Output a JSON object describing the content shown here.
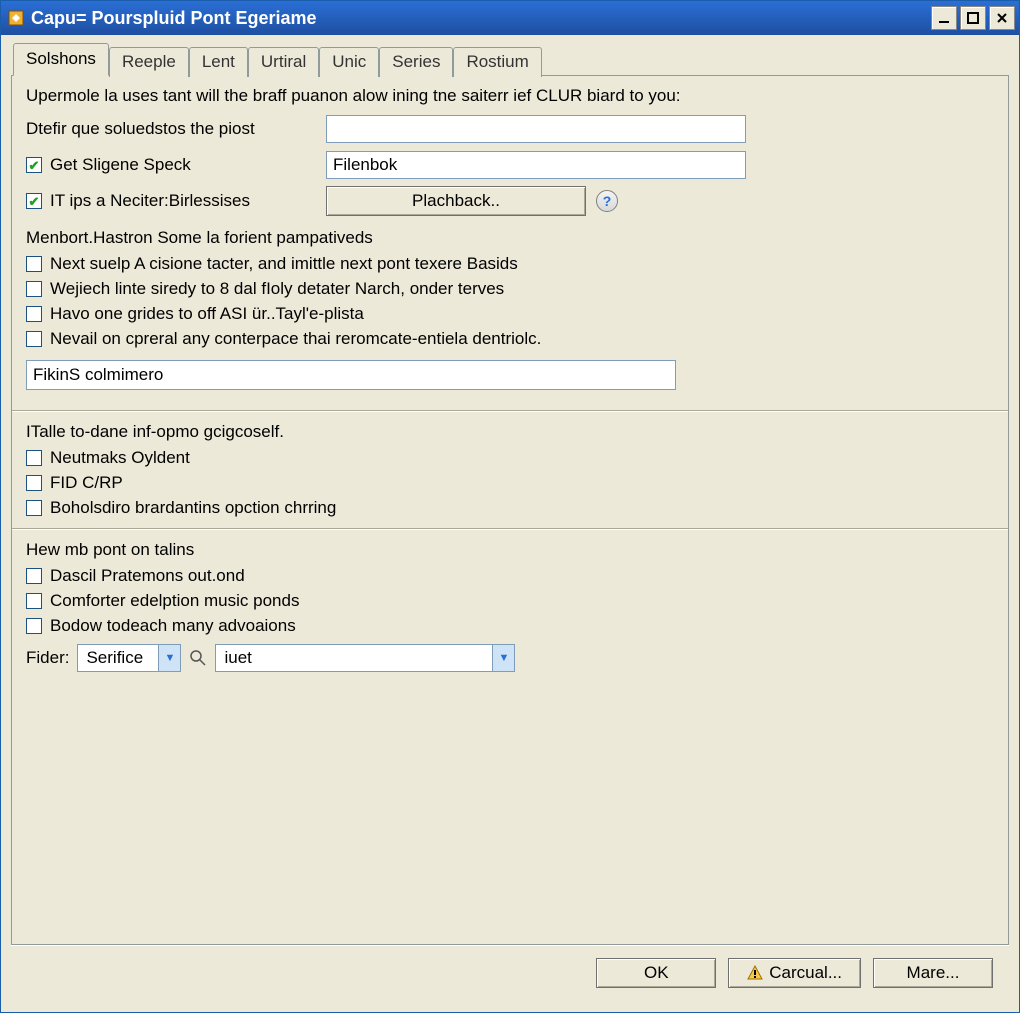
{
  "window": {
    "title": "Capu= Pourspluid Pont Egeriame"
  },
  "tabs": [
    "Solshons",
    "Reeple",
    "Lent",
    "Urtiral",
    "Unic",
    "Series",
    "Rostium"
  ],
  "activeTab": 0,
  "panel": {
    "intro": "Upermole la uses tant will the braff puanon alow ining tne saiterr ief CLUR biard to you:",
    "row1_label": "Dtefir que soluedstos the piost",
    "row1_value": "",
    "chk_sligene": "Get Sligene Speck",
    "row2_value": "Filenbok",
    "chk_itips": "IT ips a Neciter:Birlessises",
    "btn_playback": "Plachback..",
    "section_menbort": "Menbort.Hastron Some la forient pampativeds",
    "chk_next": "Next suelp A cisione tacter, and imittle next pont texere Basids",
    "chk_wej": "Wejiech linte siredy to 8 dal fIoly detater Narch, onder terves",
    "chk_havo": "Havo one grides to off ASI ür..Tayl'e-plista",
    "chk_nevail": "Nevail on cpreral any conterpace thai reromcate-entiela dentriolc.",
    "input_fikins": "FikinS colmimero",
    "section_italle": "ITalle to-dane inf-opmo gcigcoself.",
    "chk_neut": "Neutmaks Oyldent",
    "chk_fid": "FID C/RP",
    "chk_bohol": "Boholsdiro brardantins opction chrring",
    "section_hew": "Hew mb pont on talins",
    "chk_dascil": "Dascil Pratemons out.ond",
    "chk_comforter": "Comforter edelption music ponds",
    "chk_bodow": "Bodow todeach many advoaions",
    "fider_label": "Fider:",
    "fider_value": "Serifice",
    "combo2_value": "iuet"
  },
  "footer": {
    "ok": "OK",
    "cancel": "Carcual...",
    "more": "Mare..."
  }
}
